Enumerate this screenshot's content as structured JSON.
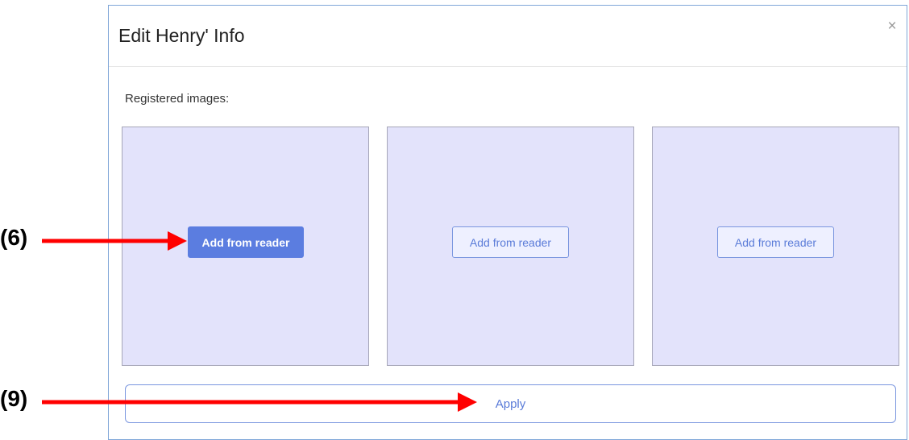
{
  "dialog": {
    "title": "Edit Henry' Info",
    "close_glyph": "×",
    "section_label": "Registered images:"
  },
  "image_slots": [
    {
      "button_label": "Add from reader",
      "state": "active"
    },
    {
      "button_label": "Add from reader",
      "state": "default"
    },
    {
      "button_label": "Add from reader",
      "state": "default"
    }
  ],
  "apply_label": "Apply",
  "callouts": [
    {
      "label": "(6)"
    },
    {
      "label": "(9)"
    }
  ],
  "colors": {
    "primary": "#5b7de0",
    "slot_background": "#e3e3fb",
    "callout_arrow": "#ff0000"
  }
}
